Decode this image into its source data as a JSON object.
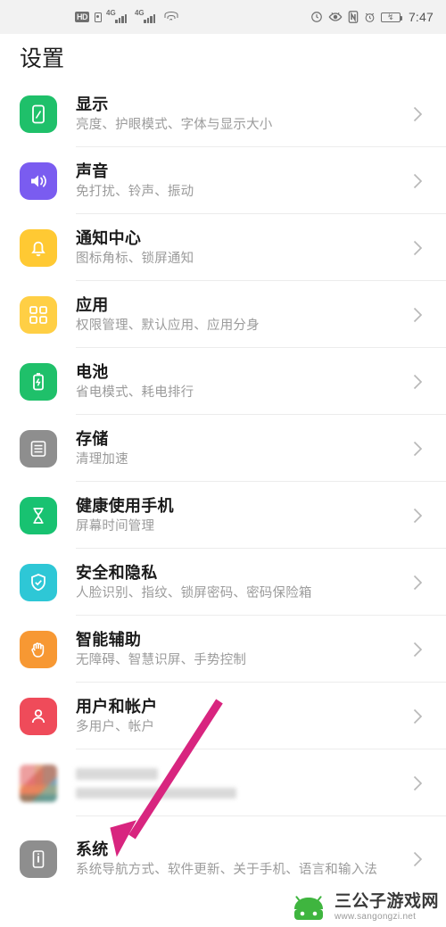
{
  "status_bar": {
    "hd_label": "HD",
    "network_label_1": "4G",
    "network_label_2": "4G",
    "icons": [
      "hd-badge",
      "sim-card-icon",
      "signal-4g-icon-1",
      "signal-4g-icon-2",
      "wifi-icon",
      "sync-icon",
      "eye-comfort-icon",
      "nfc-icon",
      "alarm-icon",
      "battery-icon"
    ],
    "sync_glyph": "◴",
    "eye_glyph": "ʖ",
    "nfc_glyph": "N",
    "alarm_glyph": "⏱",
    "battery_glyph": "↯",
    "time": "7:47"
  },
  "header": {
    "title": "设置"
  },
  "list": {
    "chevron": "›",
    "items": [
      {
        "id": "display",
        "title": "显示",
        "subtitle": "亮度、护眼模式、字体与显示大小",
        "icon": "display-phone-icon",
        "color": "#1fc06a"
      },
      {
        "id": "sound",
        "title": "声音",
        "subtitle": "免打扰、铃声、振动",
        "icon": "speaker-icon",
        "color": "#7a5cf0"
      },
      {
        "id": "notification-center",
        "title": "通知中心",
        "subtitle": "图标角标、锁屏通知",
        "icon": "bell-icon",
        "color": "#ffc933"
      },
      {
        "id": "apps",
        "title": "应用",
        "subtitle": "权限管理、默认应用、应用分身",
        "icon": "apps-grid-icon",
        "color": "#ffcf45"
      },
      {
        "id": "battery",
        "title": "电池",
        "subtitle": "省电模式、耗电排行",
        "icon": "battery-icon",
        "color": "#1fc06a"
      },
      {
        "id": "storage",
        "title": "存储",
        "subtitle": "清理加速",
        "icon": "storage-icon",
        "color": "#8e8e8e"
      },
      {
        "id": "digital-balance",
        "title": "健康使用手机",
        "subtitle": "屏幕时间管理",
        "icon": "hourglass-icon",
        "color": "#18c271"
      },
      {
        "id": "security-privacy",
        "title": "安全和隐私",
        "subtitle": "人脸识别、指纹、锁屏密码、密码保险箱",
        "icon": "shield-icon",
        "color": "#2ec7d6"
      },
      {
        "id": "smart-assistance",
        "title": "智能辅助",
        "subtitle": "无障碍、智慧识屏、手势控制",
        "icon": "hand-icon",
        "color": "#f79833"
      },
      {
        "id": "users-accounts",
        "title": "用户和帐户",
        "subtitle": "多用户、帐户",
        "icon": "person-icon",
        "color": "#ef4b5a"
      },
      {
        "id": "redacted",
        "title": "",
        "subtitle": "",
        "icon": "redacted-mosaic-icon",
        "color": "#cccccc",
        "redacted": true
      },
      {
        "id": "system",
        "title": "系统",
        "subtitle": "系统导航方式、软件更新、关于手机、语言和输入法",
        "icon": "system-info-icon",
        "color": "#8e8e8e"
      }
    ]
  },
  "annotation": {
    "arrow_color": "#d8257f",
    "arrow_label": "pointer-to-system-row"
  },
  "watermark": {
    "site_name": "三公子游戏网",
    "url": "www.sangongzi.net",
    "robot_color": "#3fb53f"
  }
}
